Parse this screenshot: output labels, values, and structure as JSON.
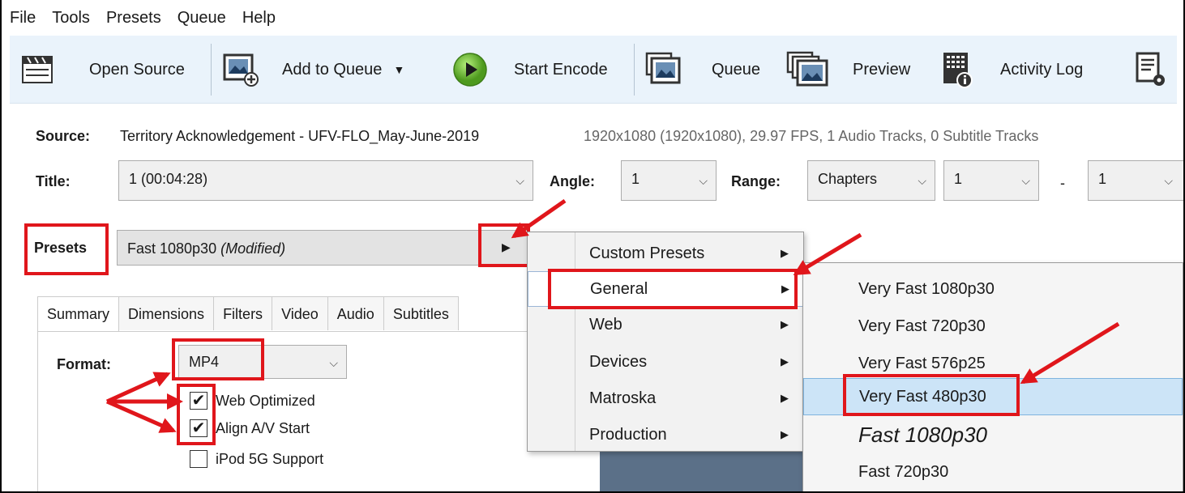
{
  "menubar": [
    "File",
    "Tools",
    "Presets",
    "Queue",
    "Help"
  ],
  "toolbar": {
    "open_source": "Open Source",
    "add_to_queue": "Add to Queue",
    "start_encode": "Start Encode",
    "queue": "Queue",
    "preview": "Preview",
    "activity_log": "Activity Log"
  },
  "source": {
    "label": "Source:",
    "name": "Territory Acknowledgement - UFV-FLO_May-June-2019",
    "info": "1920x1080 (1920x1080), 29.97 FPS, 1 Audio Tracks, 0 Subtitle Tracks"
  },
  "title": {
    "label": "Title:",
    "value": "1 (00:04:28)"
  },
  "angle": {
    "label": "Angle:",
    "value": "1"
  },
  "range": {
    "label": "Range:",
    "mode": "Chapters",
    "start": "1",
    "dash": "-",
    "end": "1"
  },
  "presets": {
    "label": "Presets",
    "value": "Fast 1080p30",
    "modified": "(Modified)"
  },
  "tabs": [
    "Summary",
    "Dimensions",
    "Filters",
    "Video",
    "Audio",
    "Subtitles"
  ],
  "format": {
    "label": "Format:",
    "value": "MP4"
  },
  "options": [
    {
      "label": "Web Optimized",
      "checked": true
    },
    {
      "label": "Align A/V Start",
      "checked": true
    },
    {
      "label": "iPod 5G Support",
      "checked": false
    }
  ],
  "preset_menu": [
    "Custom Presets",
    "General",
    "Web",
    "Devices",
    "Matroska",
    "Production"
  ],
  "general_submenu": [
    "Very Fast 1080p30",
    "Very Fast 720p30",
    "Very Fast 576p25",
    "Very Fast 480p30",
    "Fast 1080p30",
    "Fast 720p30"
  ],
  "colors": {
    "annotation_red": "#e0161b",
    "toolbar_bg": "#eaf3fb",
    "highlight": "#cce4f7"
  }
}
